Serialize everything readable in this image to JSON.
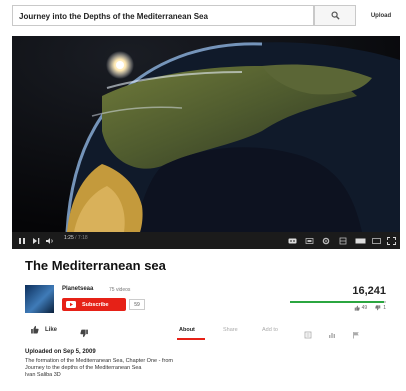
{
  "search": {
    "query": "Journey into the Depths of the Mediterranean Sea",
    "button_icon": "search-icon"
  },
  "header": {
    "upload_label": "Upload"
  },
  "player": {
    "current_time": "1:25",
    "duration": "7:18",
    "progress_fraction": 0.19,
    "controls": [
      "play-pause-icon",
      "next-icon",
      "volume-icon",
      "captions-icon",
      "settings-icon",
      "watch-later-icon",
      "theater-icon",
      "fullscreen-icon"
    ]
  },
  "video": {
    "title": "The Mediterranean sea"
  },
  "channel": {
    "name": "Planetseaa",
    "video_count": "75 videos",
    "subscribe_label": "Subscribe",
    "subscriber_count": "59"
  },
  "metrics": {
    "views": "16,241",
    "likes": "49",
    "dislikes": "1",
    "like_ratio": 0.98
  },
  "actions": {
    "like_label": "Like",
    "tabs": [
      {
        "label": "About",
        "active": true
      },
      {
        "label": "Share",
        "active": false
      },
      {
        "label": "Add to",
        "active": false
      }
    ]
  },
  "description": {
    "upload_date": "Uploaded on Sep 5, 2009",
    "lines": [
      "The formation of the Mediterranean Sea, Chapter One - from",
      "Journey to the depths of the Mediterranean Sea",
      "Ivan Saliba 3D"
    ]
  },
  "colors": {
    "accent_red": "#e62117",
    "like_green": "#2ba640"
  }
}
